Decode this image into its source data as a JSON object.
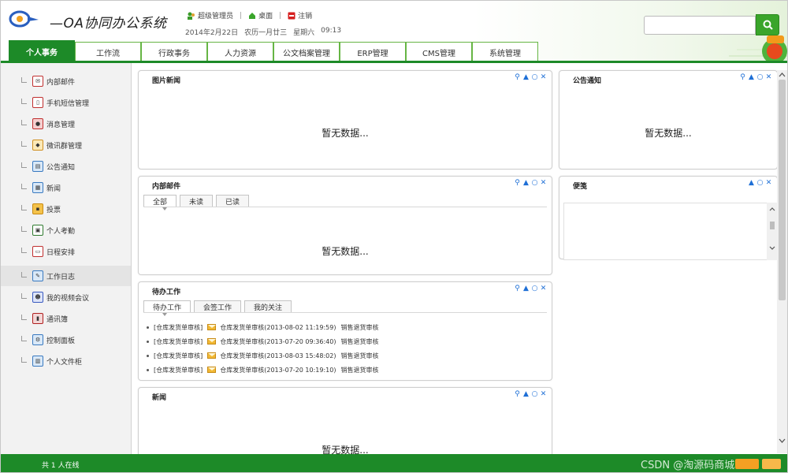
{
  "app": {
    "title": "—OA协同办公系统"
  },
  "user_bar": {
    "user_label": "超级管理员",
    "desktop_label": "桌面",
    "logout_label": "注销",
    "date": "2014年2月22日",
    "lunar": "农历一月廿三",
    "weekday": "星期六",
    "time": "09:13"
  },
  "search": {
    "placeholder": ""
  },
  "nav_tabs": [
    {
      "label": "个人事务",
      "active": true
    },
    {
      "label": "工作流"
    },
    {
      "label": "行政事务"
    },
    {
      "label": "人力资源"
    },
    {
      "label": "公文档案管理"
    },
    {
      "label": "ERP管理"
    },
    {
      "label": "CMS管理"
    },
    {
      "label": "系统管理"
    }
  ],
  "sidebar": {
    "items": [
      {
        "label": "内部邮件",
        "icon": "mail-icon"
      },
      {
        "label": "手机短信管理",
        "icon": "sms-icon"
      },
      {
        "label": "消息管理",
        "icon": "message-icon"
      },
      {
        "label": "微讯群管理",
        "icon": "group-icon"
      },
      {
        "label": "公告通知",
        "icon": "notice-icon"
      },
      {
        "label": "新闻",
        "icon": "news-icon"
      },
      {
        "label": "投票",
        "icon": "vote-icon"
      },
      {
        "label": "个人考勤",
        "icon": "attendance-icon"
      },
      {
        "label": "日程安排",
        "icon": "calendar-icon"
      },
      {
        "label": "工作日志",
        "icon": "worklog-icon",
        "active": true
      },
      {
        "label": "我的视频会议",
        "icon": "video-meeting-icon"
      },
      {
        "label": "通讯簿",
        "icon": "addressbook-icon"
      },
      {
        "label": "控制面板",
        "icon": "control-panel-icon"
      },
      {
        "label": "个人文件柜",
        "icon": "file-cabinet-icon"
      }
    ]
  },
  "portlets": {
    "photo_news": {
      "title": "图片新闻",
      "empty": "暂无数据..."
    },
    "notice": {
      "title": "公告通知",
      "empty": "暂无数据..."
    },
    "mail": {
      "title": "内部邮件",
      "tabs": [
        "全部",
        "未读",
        "已读"
      ],
      "empty": "暂无数据..."
    },
    "memo": {
      "title": "便笺"
    },
    "todo": {
      "title": "待办工作",
      "tabs": [
        "待办工作",
        "会签工作",
        "我的关注"
      ],
      "rows": [
        {
          "tag": "[仓库发货单审核]",
          "text": "仓库发货单审核(2013-08-02 11:19:59)",
          "status": "销售退货审核"
        },
        {
          "tag": "[仓库发货单审核]",
          "text": "仓库发货单审核(2013-07-20 09:36:40)",
          "status": "销售退货审核"
        },
        {
          "tag": "[仓库发货单审核]",
          "text": "仓库发货单审核(2013-08-03 15:48:02)",
          "status": "销售退货审核"
        },
        {
          "tag": "[仓库发货单审核]",
          "text": "仓库发货单审核(2013-07-20 10:19:10)",
          "status": "销售退货审核"
        }
      ]
    },
    "news": {
      "title": "新闻",
      "empty": "暂无数据..."
    }
  },
  "footer": {
    "online": "共 1 人在线",
    "watermark": "CSDN @淘源码商城"
  },
  "colors": {
    "brand_green": "#1d8a28",
    "tool_blue": "#1e6fd6"
  }
}
